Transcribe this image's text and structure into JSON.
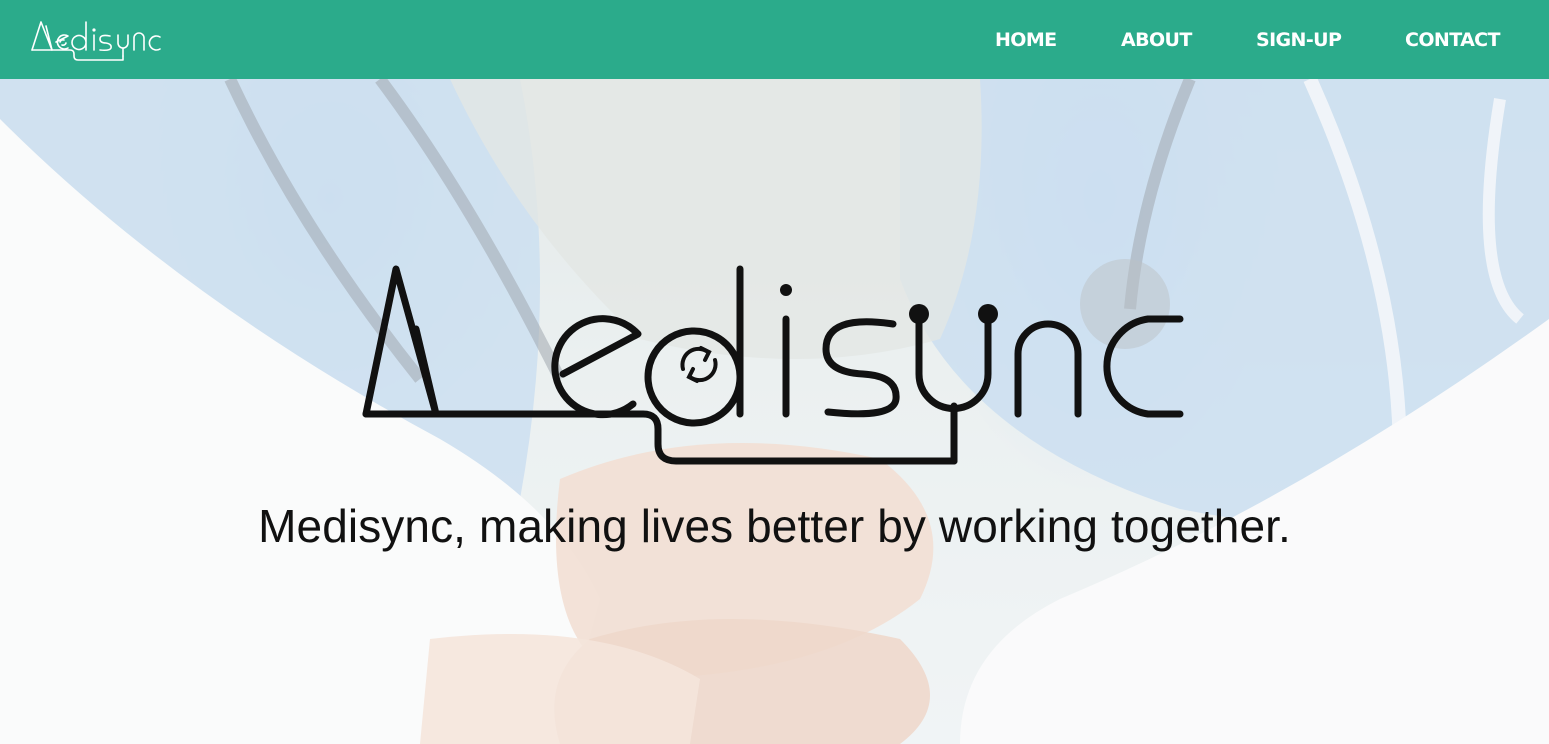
{
  "brand": {
    "name": "Medisync",
    "logo_icon": "medisync-stethoscope-sync-logo"
  },
  "nav": {
    "items": [
      {
        "label": "HOME"
      },
      {
        "label": "ABOUT"
      },
      {
        "label": "SIGN-UP"
      },
      {
        "label": "CONTACT"
      }
    ]
  },
  "hero": {
    "tagline": "Medisync, making lives better by working together.",
    "background_image": "medical-team-stacked-hands-photo"
  },
  "colors": {
    "nav_background": "#2bab8b",
    "nav_text": "#ffffff",
    "logo_stroke": "#111111",
    "tagline_text": "#111111"
  }
}
